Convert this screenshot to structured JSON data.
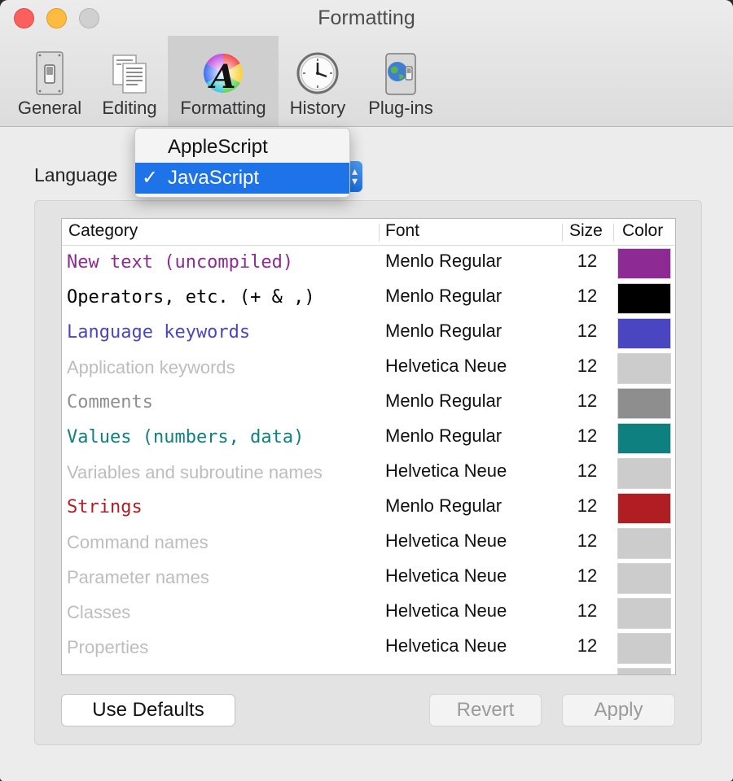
{
  "window": {
    "title": "Formatting"
  },
  "toolbar": {
    "items": [
      {
        "label": "General",
        "icon": "switch-icon"
      },
      {
        "label": "Editing",
        "icon": "documents-icon"
      },
      {
        "label": "Formatting",
        "icon": "font-color-wheel-icon",
        "selected": true
      },
      {
        "label": "History",
        "icon": "clock-icon"
      },
      {
        "label": "Plug-ins",
        "icon": "plugins-icon"
      }
    ]
  },
  "language": {
    "label": "Language",
    "selected": "JavaScript",
    "options": [
      {
        "label": "AppleScript",
        "checked": false
      },
      {
        "label": "JavaScript",
        "checked": true,
        "check_mark": "✓"
      }
    ]
  },
  "table": {
    "headers": {
      "category": "Category",
      "font": "Font",
      "size": "Size",
      "color": "Color"
    },
    "rows": [
      {
        "category": "New text (uncompiled)",
        "font": "Menlo Regular",
        "size": "12",
        "color": "#8e2a93",
        "text_color": "#8e2a93",
        "mono": true
      },
      {
        "category": "Operators, etc. (+ & ,)",
        "font": "Menlo Regular",
        "size": "12",
        "color": "#000000",
        "text_color": "#000000",
        "mono": true
      },
      {
        "category": "Language keywords",
        "font": "Menlo Regular",
        "size": "12",
        "color": "#4a45c0",
        "text_color": "#4a45c0",
        "mono": true
      },
      {
        "category": "Application keywords",
        "font": "Helvetica Neue",
        "size": "12",
        "color": "#cccccc",
        "text_color": "#bdbdbd",
        "mono": false
      },
      {
        "category": "Comments",
        "font": "Menlo Regular",
        "size": "12",
        "color": "#8e8e8e",
        "text_color": "#8e8e8e",
        "mono": true
      },
      {
        "category": "Values (numbers, data)",
        "font": "Menlo Regular",
        "size": "12",
        "color": "#0f8080",
        "text_color": "#0f8080",
        "mono": true
      },
      {
        "category": "Variables and subroutine names",
        "font": "Helvetica Neue",
        "size": "12",
        "color": "#cccccc",
        "text_color": "#bdbdbd",
        "mono": false
      },
      {
        "category": "Strings",
        "font": "Menlo Regular",
        "size": "12",
        "color": "#b01e24",
        "text_color": "#b01e24",
        "mono": true
      },
      {
        "category": "Command names",
        "font": "Helvetica Neue",
        "size": "12",
        "color": "#cccccc",
        "text_color": "#bdbdbd",
        "mono": false
      },
      {
        "category": "Parameter names",
        "font": "Helvetica Neue",
        "size": "12",
        "color": "#cccccc",
        "text_color": "#bdbdbd",
        "mono": false
      },
      {
        "category": "Classes",
        "font": "Helvetica Neue",
        "size": "12",
        "color": "#cccccc",
        "text_color": "#bdbdbd",
        "mono": false
      },
      {
        "category": "Properties",
        "font": "Helvetica Neue",
        "size": "12",
        "color": "#cccccc",
        "text_color": "#bdbdbd",
        "mono": false
      }
    ]
  },
  "buttons": {
    "use_defaults": "Use Defaults",
    "revert": "Revert",
    "apply": "Apply"
  }
}
